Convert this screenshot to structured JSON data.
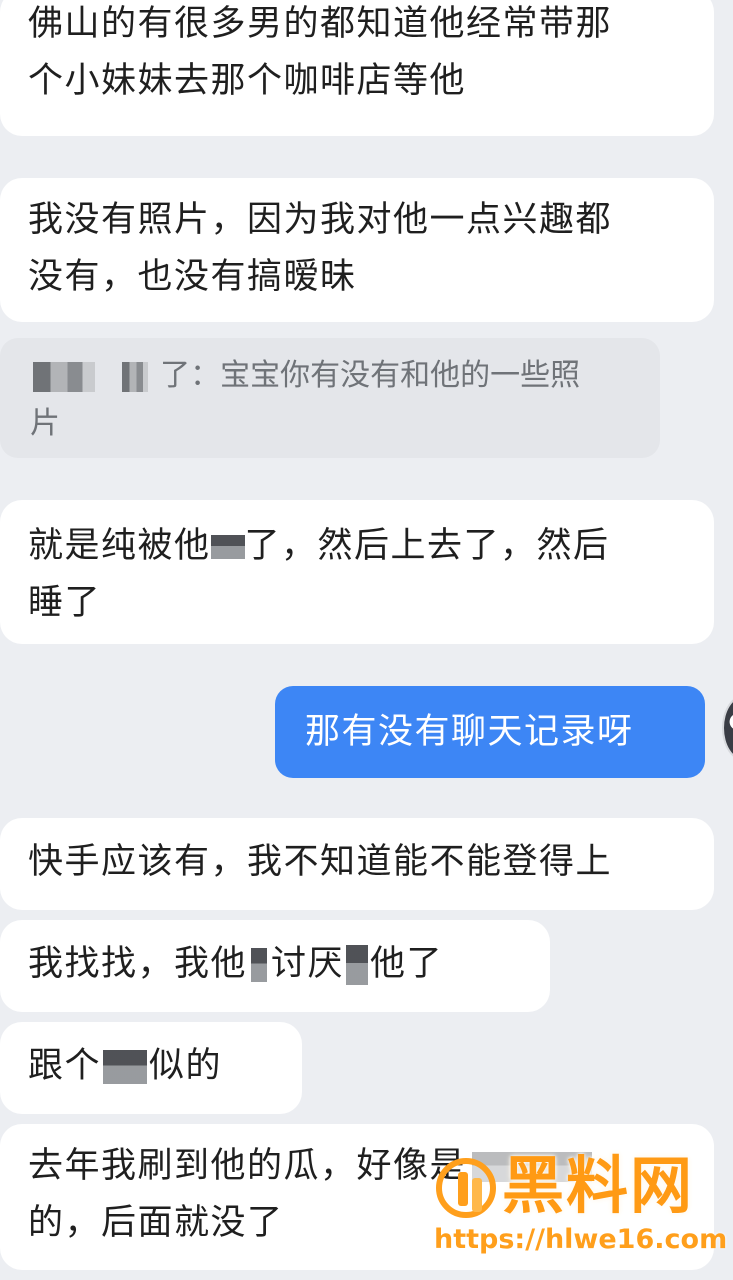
{
  "messages": [
    {
      "lines": [
        "佛山的有很多男的都知道他经常带那",
        "个小妹妹去那个咖啡店等他"
      ]
    },
    {
      "lines": [
        "我没有照片，因为我对他一点兴趣都",
        "没有，也没有搞暧昧"
      ]
    },
    {
      "quote_suffix": "了：宝宝你有没有和他的一些照",
      "quote_line2": "片"
    },
    {
      "part1": "就是纯被他",
      "part2": "了，然后上去了，然后",
      "line2": "睡了"
    },
    {
      "text": "那有没有聊天记录呀"
    },
    {
      "text": "快手应该有，我不知道能不能登得上"
    },
    {
      "part1": "我找找，我他",
      "part2": "讨厌",
      "part3": "他了"
    },
    {
      "part1": "跟个",
      "part2": "似的"
    },
    {
      "lines": [
        "去年我刷到他的瓜，好像是",
        "的，后面就没了"
      ]
    }
  ],
  "watermark": {
    "title": "黑料网",
    "url": "https://hlwe16.com"
  },
  "colors": {
    "background": "#eceef2",
    "incoming_bubble": "#ffffff",
    "outgoing_bubble": "#3d86f5",
    "watermark": "#ff9a14"
  }
}
